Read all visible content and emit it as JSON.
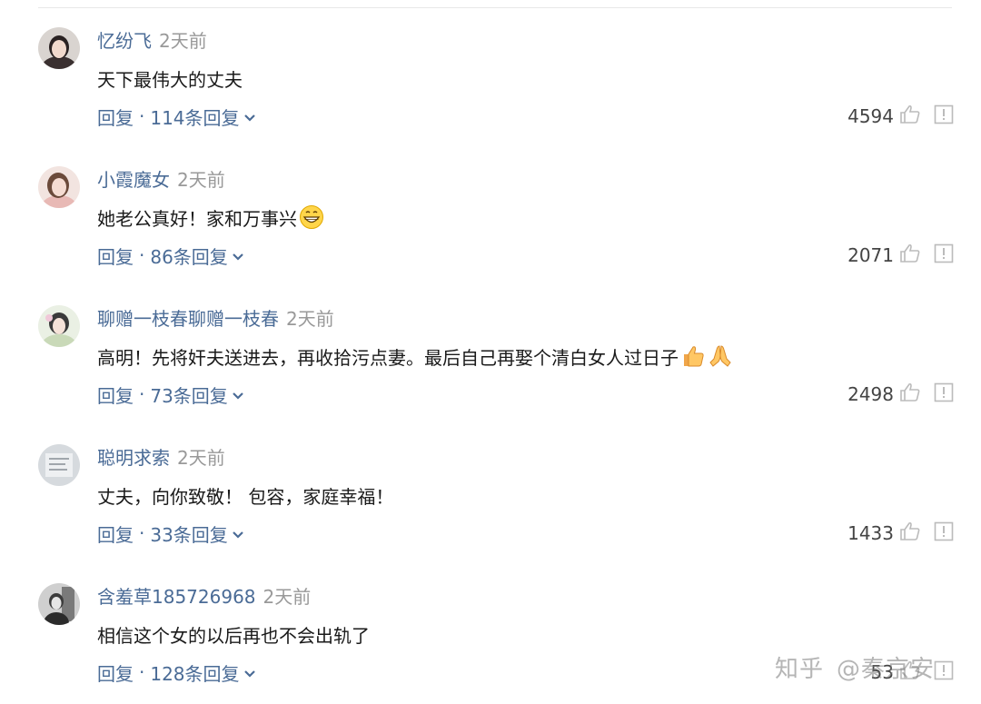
{
  "comments": [
    {
      "username": "忆纷飞",
      "time": "2天前",
      "text": "天下最伟大的丈夫",
      "reply_label": "回复",
      "replies": "114条回复",
      "likes": "4594"
    },
    {
      "username": "小霞魔女",
      "time": "2天前",
      "text": "她老公真好！家和万事兴",
      "reply_label": "回复",
      "replies": "86条回复",
      "likes": "2071"
    },
    {
      "username": "聊赠一枝春聊赠一枝春",
      "time": "2天前",
      "text": "高明！先将奸夫送进去，再收拾污点妻。最后自己再娶个清白女人过日子",
      "reply_label": "回复",
      "replies": "73条回复",
      "likes": "2498"
    },
    {
      "username": "聪明求索",
      "time": "2天前",
      "text": "丈夫，向你致敬！ 包容，家庭幸福！",
      "reply_label": "回复",
      "replies": "33条回复",
      "likes": "1433"
    },
    {
      "username": "含羞草185726968",
      "time": "2天前",
      "text": "相信这个女的以后再也不会出轨了",
      "reply_label": "回复",
      "replies": "128条回复",
      "likes": "53"
    }
  ],
  "separator": "·",
  "watermark": {
    "site": "知乎",
    "author": "@秦京安"
  },
  "colors": {
    "username": "#4a6b96",
    "time": "#999999",
    "text": "#1a1a1a",
    "likes": "#444444"
  },
  "icons": [
    "avatar",
    "grin-emoji",
    "thumbs-up-emoji",
    "pray-emoji",
    "chevron-down-icon",
    "thumbs-up-icon",
    "report-icon"
  ]
}
